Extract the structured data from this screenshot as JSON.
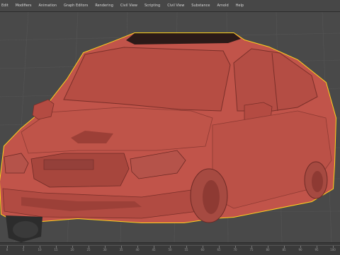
{
  "menu": {
    "items": [
      "Edit",
      "Modifiers",
      "Animation",
      "Graph Editors",
      "Rendering",
      "Civil View",
      "Scripting",
      "Civil View",
      "Substance",
      "Arnold",
      "Help"
    ]
  },
  "viewport": {
    "object": "car-model",
    "colors": {
      "background": "#494949",
      "grid": "#555555",
      "body": "#c1544a",
      "body_dark": "#8e3a33",
      "selection_outline": "#ffd21c",
      "tire": "#2c2c2c"
    }
  },
  "timeline": {
    "ticks": [
      "0",
      "5",
      "10",
      "15",
      "20",
      "25",
      "30",
      "35",
      "40",
      "45",
      "50",
      "55",
      "60",
      "65",
      "70",
      "75",
      "80",
      "85",
      "90",
      "95",
      "100"
    ]
  }
}
